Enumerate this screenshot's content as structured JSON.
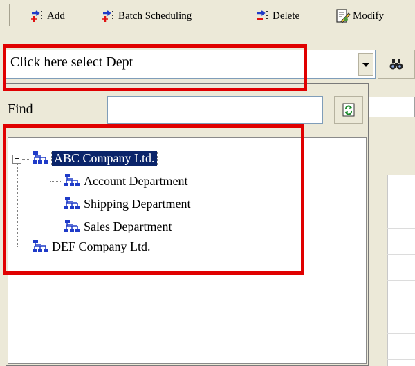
{
  "toolbar": {
    "add_label": "Add",
    "batch_label": "Batch Scheduling",
    "delete_label": "Delete",
    "modify_label": "Modify"
  },
  "dept_select": {
    "placeholder": "Click here select Dept"
  },
  "find": {
    "label": "Find",
    "value": ""
  },
  "tree": {
    "companies": [
      {
        "name": "ABC Company Ltd.",
        "expanded": true,
        "selected": true,
        "departments": [
          "Account Department",
          "Shipping Department",
          "Sales Department"
        ]
      },
      {
        "name": "DEF Company Ltd.",
        "expanded": false,
        "selected": false,
        "departments": []
      }
    ]
  },
  "colors": {
    "highlight": "#e00000",
    "selection": "#0a246a",
    "window_bg": "#ece9d8"
  },
  "icons": [
    "add-icon",
    "batch-scheduling-icon",
    "delete-icon",
    "modify-icon",
    "binoculars-icon",
    "refresh-icon",
    "org-chart-icon"
  ]
}
